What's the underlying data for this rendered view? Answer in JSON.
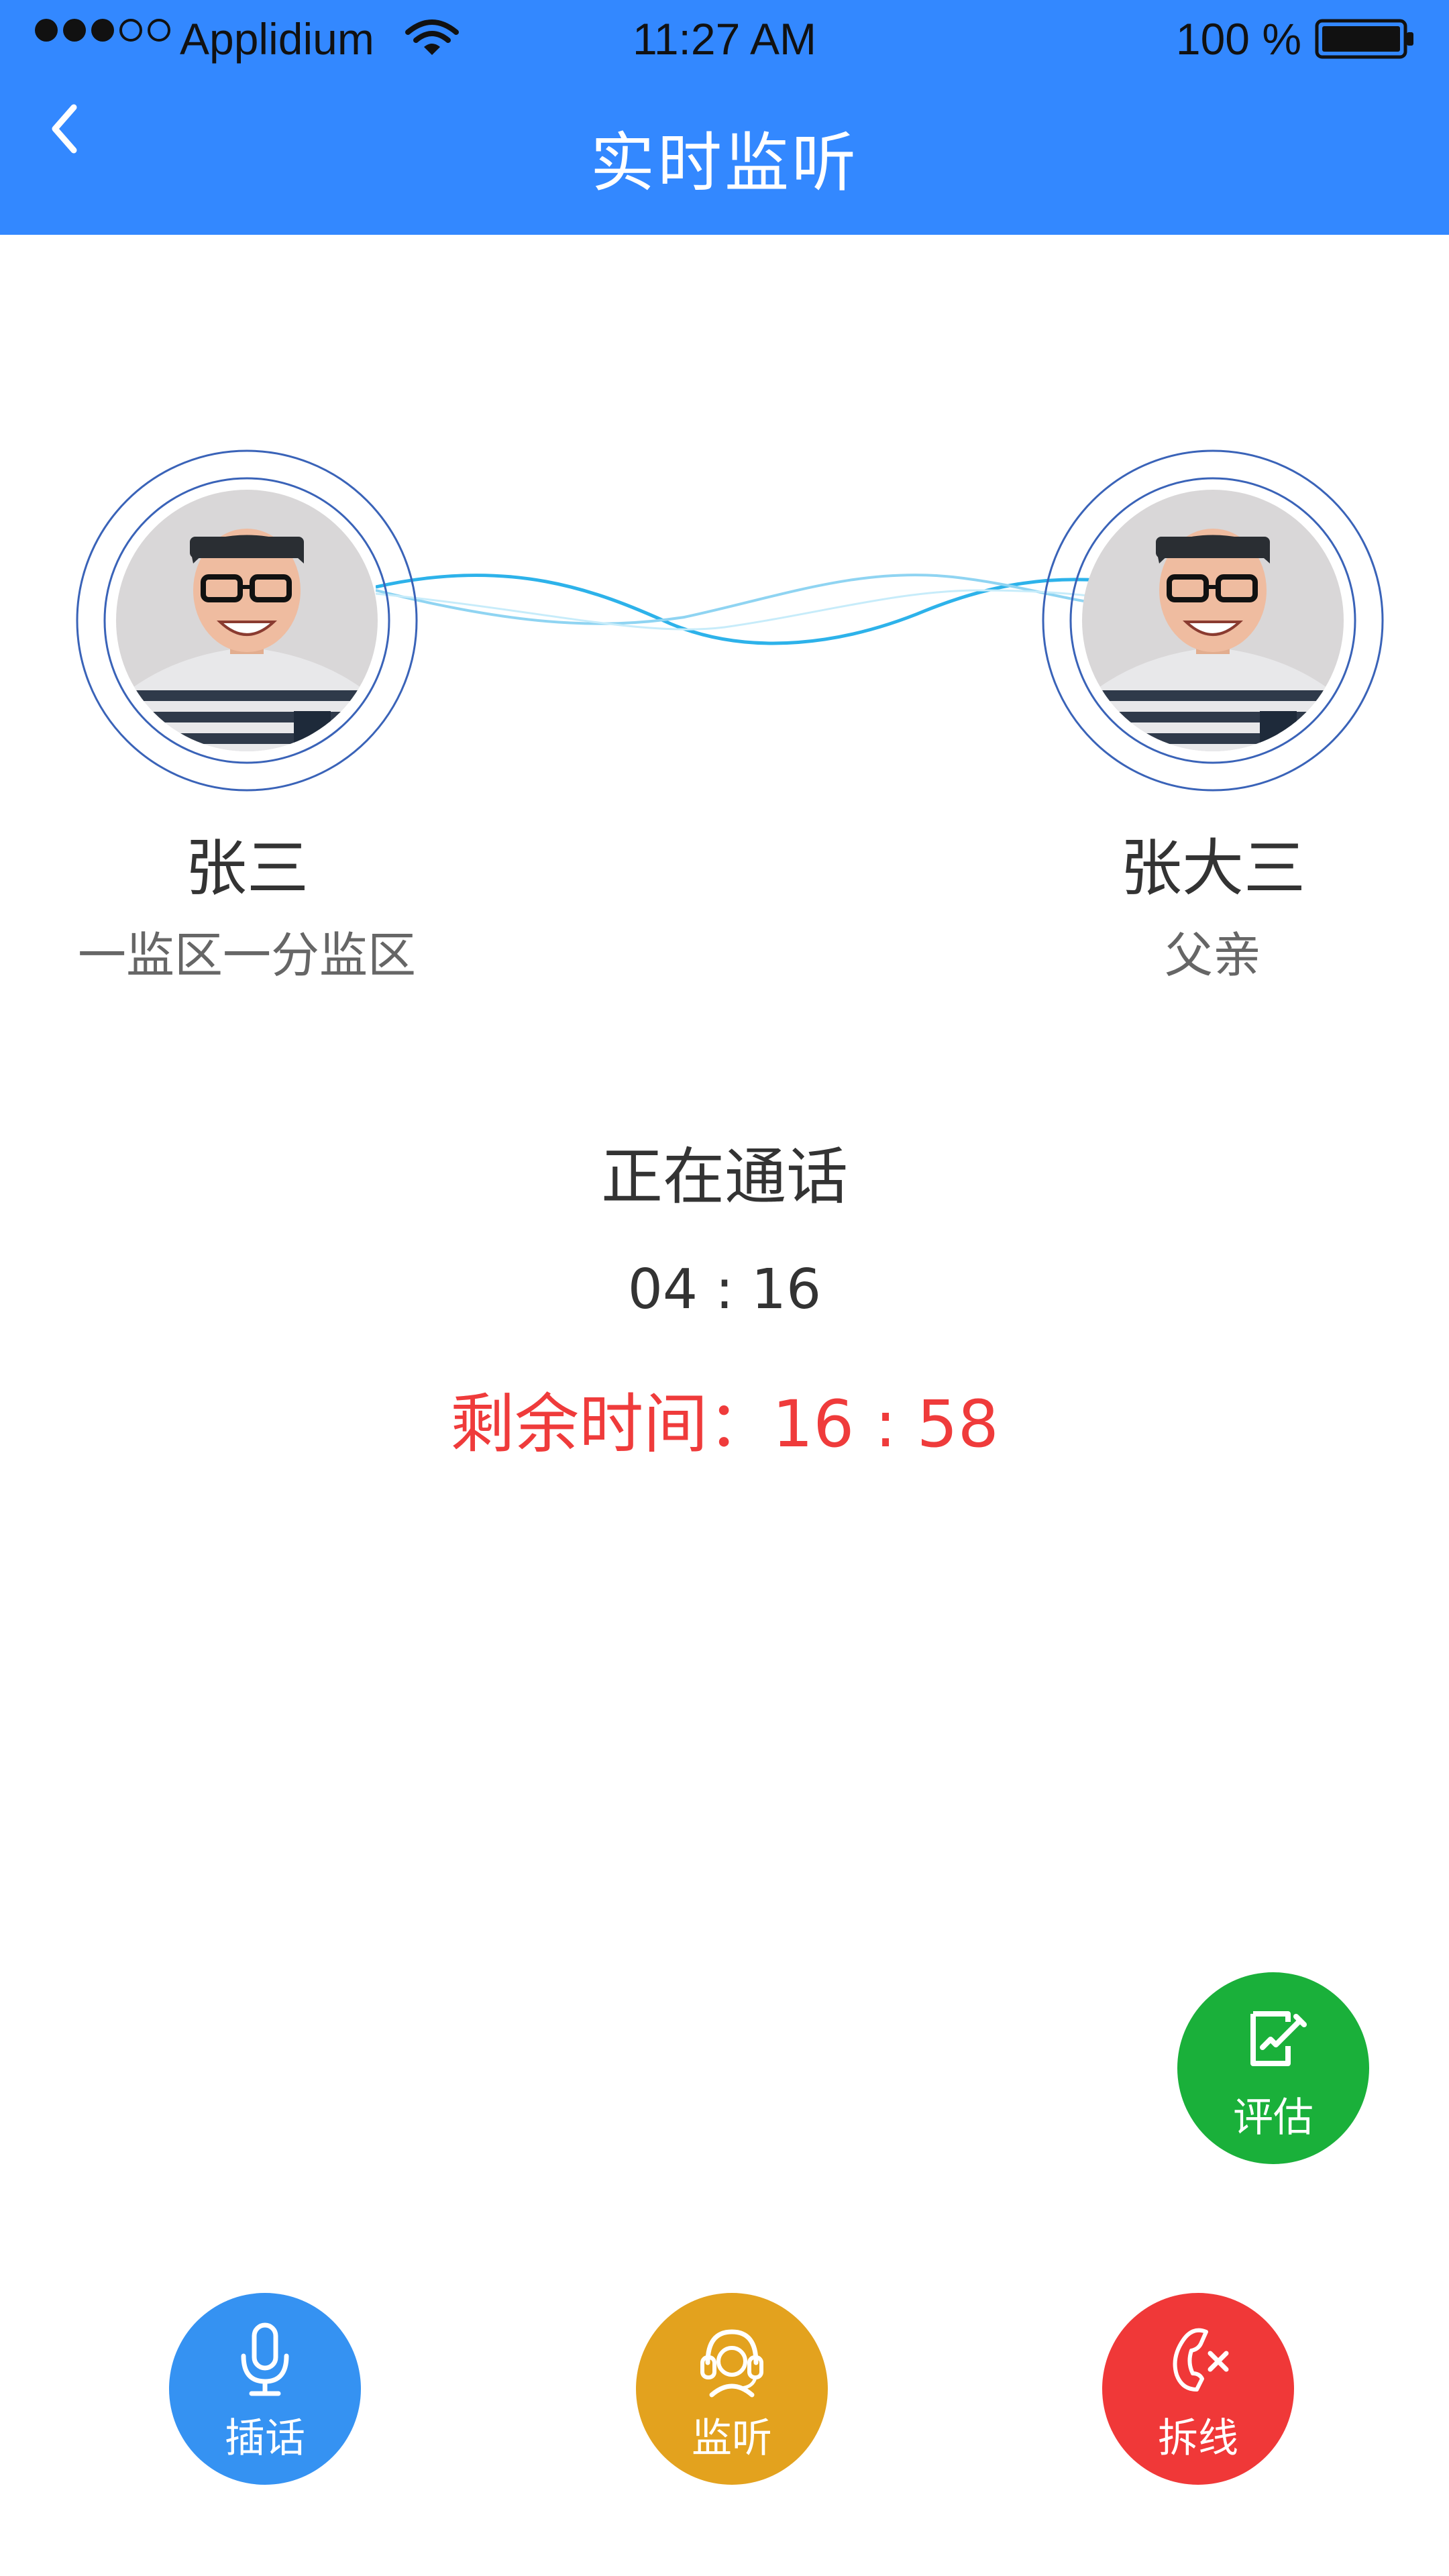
{
  "status_bar": {
    "carrier": "Applidium",
    "time": "11:27 AM",
    "battery": "100 %",
    "signal_bars_filled": 3,
    "signal_bars_total": 5
  },
  "nav": {
    "title": "实时监听",
    "back_icon": "chevron-left-icon"
  },
  "participants": {
    "left": {
      "name": "张三",
      "subtitle": "一监区一分监区"
    },
    "right": {
      "name": "张大三",
      "subtitle": "父亲"
    }
  },
  "call": {
    "status": "正在通话",
    "duration": "04 : 16",
    "remaining": "剩余时间：16 : 58"
  },
  "actions": {
    "evaluate": {
      "label": "评估",
      "icon": "edit-icon",
      "color": "#1ab03a"
    },
    "interject": {
      "label": "插话",
      "icon": "microphone-icon",
      "color": "#3592f2"
    },
    "monitor": {
      "label": "监听",
      "icon": "headset-icon",
      "color": "#e3a21e"
    },
    "hangup": {
      "label": "拆线",
      "icon": "phone-hangup-icon",
      "color": "#f03838"
    }
  },
  "theme": {
    "header_color": "#3388ff",
    "alert_color": "#ef3b3b"
  }
}
